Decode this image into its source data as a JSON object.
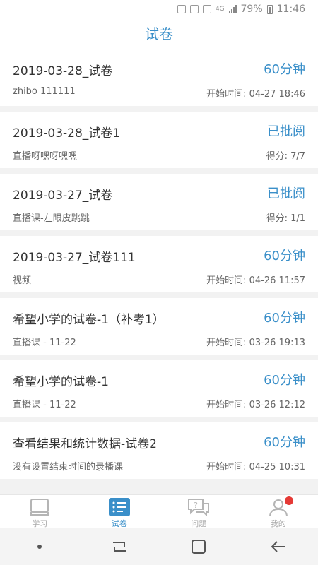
{
  "status_bar": {
    "battery": "79%",
    "time": "11:46",
    "network": "4G"
  },
  "header": {
    "title": "试卷"
  },
  "exams": [
    {
      "title": "2019-03-28_试卷",
      "status": "60分钟",
      "subtitle": "zhibo 111111",
      "meta": "开始时间: 04-27 18:46"
    },
    {
      "title": "2019-03-28_试卷1",
      "status": "已批阅",
      "subtitle": "直播呀嘿呀嘿嘿",
      "meta": "得分: 7/7"
    },
    {
      "title": "2019-03-27_试卷",
      "status": "已批阅",
      "subtitle": "直播课-左眼皮跳跳",
      "meta": "得分: 1/1"
    },
    {
      "title": "2019-03-27_试卷111",
      "status": "60分钟",
      "subtitle": "视频",
      "meta": "开始时间: 04-26 11:57"
    },
    {
      "title": "希望小学的试卷-1（补考1）",
      "status": "60分钟",
      "subtitle": "直播课 - 11-22",
      "meta": "开始时间: 03-26 19:13"
    },
    {
      "title": "希望小学的试卷-1",
      "status": "60分钟",
      "subtitle": "直播课 - 11-22",
      "meta": "开始时间: 03-26 12:12"
    },
    {
      "title": "查看结果和统计数据-试卷2",
      "status": "60分钟",
      "subtitle": "没有设置结束时间的录播课",
      "meta": "开始时间: 04-25 10:31"
    }
  ],
  "tabs": [
    {
      "label": "学习",
      "icon": "book-icon"
    },
    {
      "label": "试卷",
      "icon": "exam-list-icon",
      "active": true
    },
    {
      "label": "问题",
      "icon": "question-chat-icon"
    },
    {
      "label": "我的",
      "icon": "user-icon"
    }
  ],
  "colors": {
    "accent": "#3a8fc9",
    "badge": "#e53935"
  }
}
